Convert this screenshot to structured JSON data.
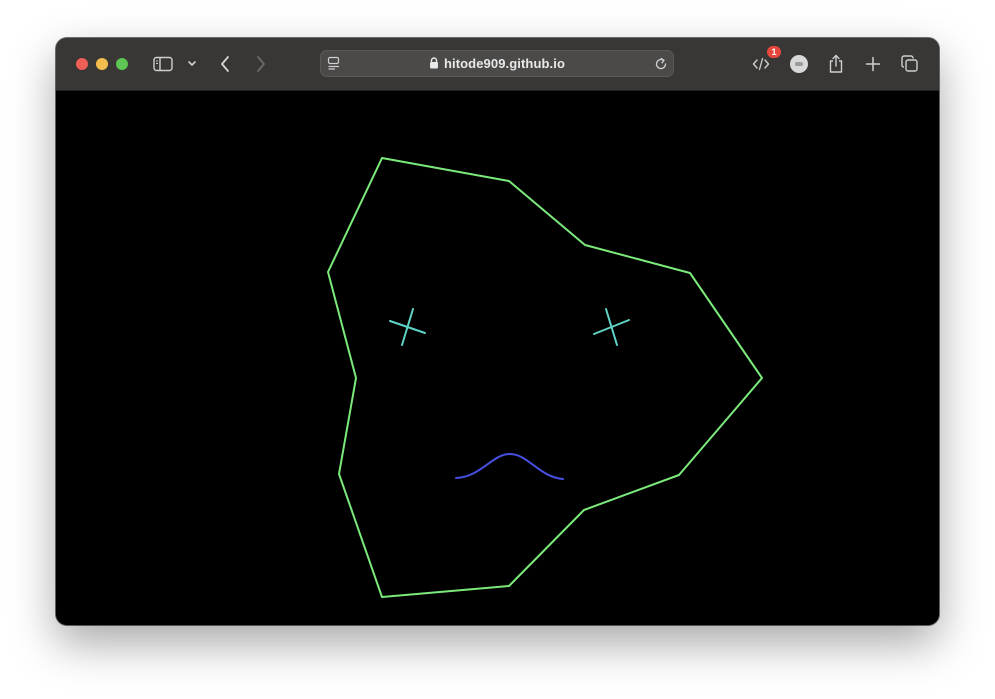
{
  "browser": {
    "url": "hitode909.github.io",
    "notification_count": "1",
    "icons": {
      "sidebar": "sidebar-icon",
      "tab_menu": "chevron-down-icon",
      "back": "back-arrow-icon",
      "forward": "forward-arrow-icon",
      "page_menu": "page-menu-icon",
      "lock": "lock-icon",
      "reload": "reload-icon",
      "devtools": "code-icon",
      "profile": "avatar",
      "share": "share-icon",
      "new_tab": "plus-icon",
      "tabs_overview": "tabs-overview-icon"
    }
  },
  "canvas": {
    "background": "#000000",
    "face_color": "#7bea7b",
    "eye_color": "#5fd4c6",
    "mouth_color": "#4650e0"
  }
}
